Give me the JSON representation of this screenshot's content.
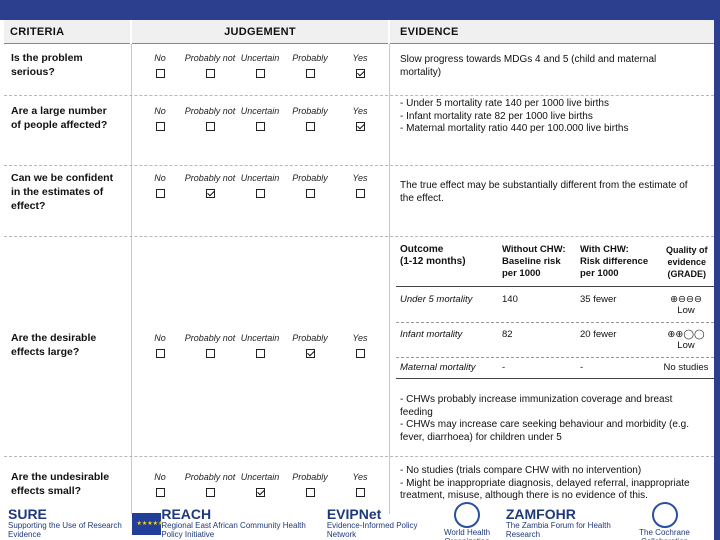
{
  "headers": {
    "criteria": "CRITERIA",
    "judgement": "JUDGEMENT",
    "evidence": "EVIDENCE"
  },
  "options": [
    "No",
    "Probably not",
    "Uncertain",
    "Probably",
    "Yes"
  ],
  "rows": [
    {
      "criteria": [
        "Is the problem",
        "serious?"
      ],
      "checked": 4,
      "evidence": [
        "Slow progress towards MDGs 4 and 5 (child and maternal",
        "mortality)"
      ]
    },
    {
      "criteria": [
        "Are a large number",
        "of people affected?"
      ],
      "checked": 4,
      "evidence": [
        "- Under 5 mortality rate 140 per 1000 live births",
        "- Infant mortality rate 82 per 1000 live births",
        "- Maternal mortality ratio 440 per 100.000  live births"
      ]
    },
    {
      "criteria": [
        "Can we be confident",
        "in the estimates of",
        "effect?"
      ],
      "checked": 1,
      "evidence": [
        "The true effect may be substantially different from the estimate of",
        "the effect."
      ]
    },
    {
      "criteria": [
        "Are the desirable",
        "effects large?"
      ],
      "checked": 3,
      "evidence": [
        "- CHWs probably increase immunization coverage and breast",
        "feeding",
        "- CHWs may increase care seeking behaviour and morbidity (e.g.",
        "fever, diarrhoea) for children under 5"
      ]
    },
    {
      "criteria": [
        "Are the undesirable",
        "effects small?"
      ],
      "checked": 2,
      "evidence": [
        "- No studies (trials compare CHW with no intervention)",
        "- Might be inappropriate diagnosis, delayed referral, inappropriate",
        "treatment, misuse, although there is no evidence of this."
      ]
    }
  ],
  "outcome_table": {
    "headers": {
      "outcome": [
        "Outcome",
        "(1-12 months)"
      ],
      "without": [
        "Without CHW:",
        "Baseline risk",
        "per 1000"
      ],
      "with": [
        "With CHW:",
        "Risk difference",
        "per 1000"
      ],
      "quality": [
        "Quality of",
        "evidence",
        "(GRADE)"
      ]
    },
    "rows": [
      {
        "outcome": "Under 5 mortality",
        "baseline": "140",
        "difference": "35 fewer",
        "quality_symbols": "⊕⊖⊖⊖",
        "quality": "Low"
      },
      {
        "outcome": "Infant mortality",
        "baseline": "82",
        "difference": "20 fewer",
        "quality_symbols": "⊕⊕◯◯",
        "quality": "Low"
      },
      {
        "outcome": "Maternal mortality",
        "baseline": "-",
        "difference": "-",
        "quality_symbols": "",
        "quality": "No studies"
      }
    ]
  },
  "footer": {
    "logos": [
      {
        "name": "SURE",
        "text": "SURE",
        "sub": "Supporting the Use of Research Evidence"
      },
      {
        "name": "EU",
        "text": "",
        "sub": ""
      },
      {
        "name": "REACH",
        "text": "REACH",
        "sub": "Regional East African Community Health Policy Initiative"
      },
      {
        "name": "EVIPNet",
        "text": "EVIPNet",
        "sub": "Evidence-Informed Policy Network"
      },
      {
        "name": "WHO",
        "text": "",
        "sub": "World Health Organization"
      },
      {
        "name": "ZAMFOHR",
        "text": "ZAMFOHR",
        "sub": "The Zambia Forum for Health Research"
      },
      {
        "name": "Cochrane",
        "text": "",
        "sub": "The Cochrane Collaboration"
      }
    ]
  },
  "colors": {
    "bar": "#2b3f8e",
    "footer_text": "#1e3a7a"
  }
}
